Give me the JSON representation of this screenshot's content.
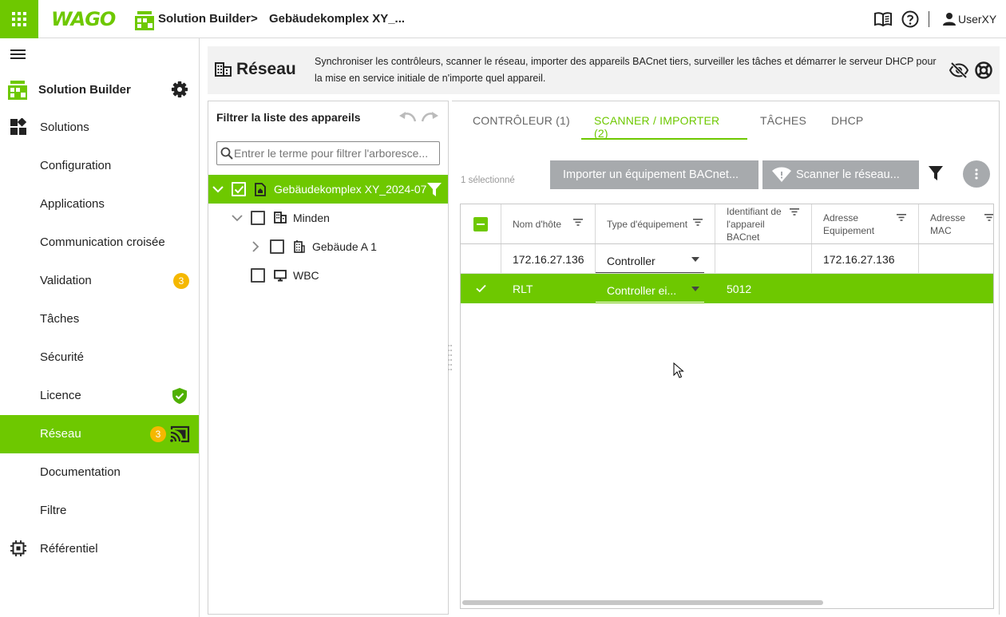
{
  "topbar": {
    "brand": "WAGO",
    "app_title": "Solution Builder",
    "breadcrumb_sep": ">",
    "project": "Gebäudekomplex XY_...",
    "user": "UserXY",
    "divider": "|"
  },
  "sidebar": {
    "title": "Solution Builder",
    "items": [
      {
        "label": "Solutions",
        "icon": "dashboard-icon"
      },
      {
        "label": "Configuration"
      },
      {
        "label": "Applications"
      },
      {
        "label": "Communication croisée"
      },
      {
        "label": "Validation",
        "badge": "3"
      },
      {
        "label": "Tâches"
      },
      {
        "label": "Sécurité"
      },
      {
        "label": "Licence",
        "icon": "shield-check-icon"
      },
      {
        "label": "Réseau",
        "badge": "3",
        "icon": "cast-icon",
        "active": true
      },
      {
        "label": "Documentation"
      },
      {
        "label": "Filtre"
      },
      {
        "label": "Référentiel",
        "icon": "chip-icon"
      }
    ]
  },
  "header": {
    "title": "Réseau",
    "description": "Synchroniser les contrôleurs, scanner le réseau, importer des appareils BACnet tiers, surveiller les tâches et démarrer le serveur DHCP pour la mise en service initiale de n'importe quel appareil."
  },
  "tree": {
    "title": "Filtrer la liste des appareils",
    "filter_placeholder": "Entrer le terme pour filtrer l'arboresce...",
    "nodes": [
      {
        "label": "Gebäudekomplex XY_2024-07",
        "checked": true,
        "selected": true
      },
      {
        "label": "Minden",
        "checked": false
      },
      {
        "label": "Gebäude A 1",
        "checked": false
      },
      {
        "label": "WBC",
        "checked": false
      }
    ]
  },
  "tabs": [
    {
      "label": "CONTRÔLEUR (1)",
      "active": false
    },
    {
      "label": "SCANNER / IMPORTER (2)",
      "active": true
    },
    {
      "label": "TÂCHES",
      "active": false
    },
    {
      "label": "DHCP",
      "active": false
    }
  ],
  "toolbar": {
    "selected_count": "1 sélectionné",
    "import_button": "Importer un équipement BACnet...",
    "scan_button": "Scanner le réseau..."
  },
  "grid": {
    "columns": [
      {
        "h1": "Nom d'hôte"
      },
      {
        "h1": "Type d'équipement"
      },
      {
        "h1": "Identifiant de",
        "h2": "l'appareil",
        "h3": "BACnet"
      },
      {
        "h1": "Adresse",
        "h2": "Equipement"
      },
      {
        "h1": "Adresse",
        "h2": "MAC"
      }
    ],
    "rows": [
      {
        "host": "172.16.27.136",
        "type": "Controller",
        "bacnet_id": "",
        "address": "172.16.27.136",
        "mac": "",
        "selected": false
      },
      {
        "host": "RLT",
        "type": "Controller ei...",
        "bacnet_id": "5012",
        "address": "",
        "mac": "",
        "selected": true
      }
    ]
  },
  "colors": {
    "accent": "#6ec800",
    "badge": "#f5b800",
    "button_gray": "#a7aaad"
  }
}
